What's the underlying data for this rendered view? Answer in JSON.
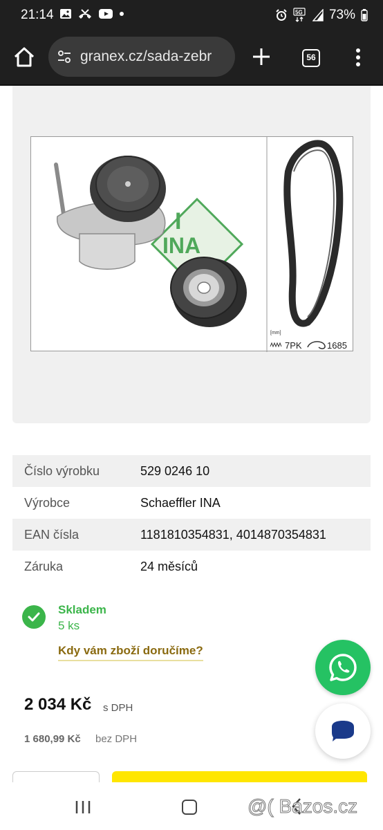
{
  "status_bar": {
    "time": "21:14",
    "battery": "73%",
    "network": "5G",
    "icons_left": [
      "image-icon",
      "missed-call-icon",
      "youtube-icon",
      "dot-icon"
    ],
    "icons_right": [
      "alarm-icon",
      "5g-icon",
      "signal-icon",
      "battery-icon"
    ]
  },
  "browser": {
    "url": "granex.cz/sada-zebr",
    "tab_count": "56"
  },
  "product_image": {
    "brand_logo_text": "INA",
    "unit_label": "[mm]",
    "belt_profile": "7PK",
    "belt_length": "1685"
  },
  "specs": [
    {
      "label": "Číslo výrobku",
      "value": "529 0246 10"
    },
    {
      "label": "Výrobce",
      "value": "Schaeffler INA"
    },
    {
      "label": "EAN čísla",
      "value": "1181810354831, 4014870354831"
    },
    {
      "label": "Záruka",
      "value": "24 měsíců"
    }
  ],
  "stock": {
    "status": "Skladem",
    "quantity": "5 ks",
    "delivery_link": "Kdy vám zboží doručíme?"
  },
  "price": {
    "with_vat": "2 034 Kč",
    "with_vat_note": "s DPH",
    "without_vat": "1 680,99 Kč",
    "without_vat_note": "bez DPH"
  },
  "watermark": "@( Bazos.cz",
  "colors": {
    "accent_green": "#3bb54a",
    "whatsapp_green": "#25c263",
    "buy_yellow": "#ffe600",
    "link_brown": "#8a6a10"
  }
}
